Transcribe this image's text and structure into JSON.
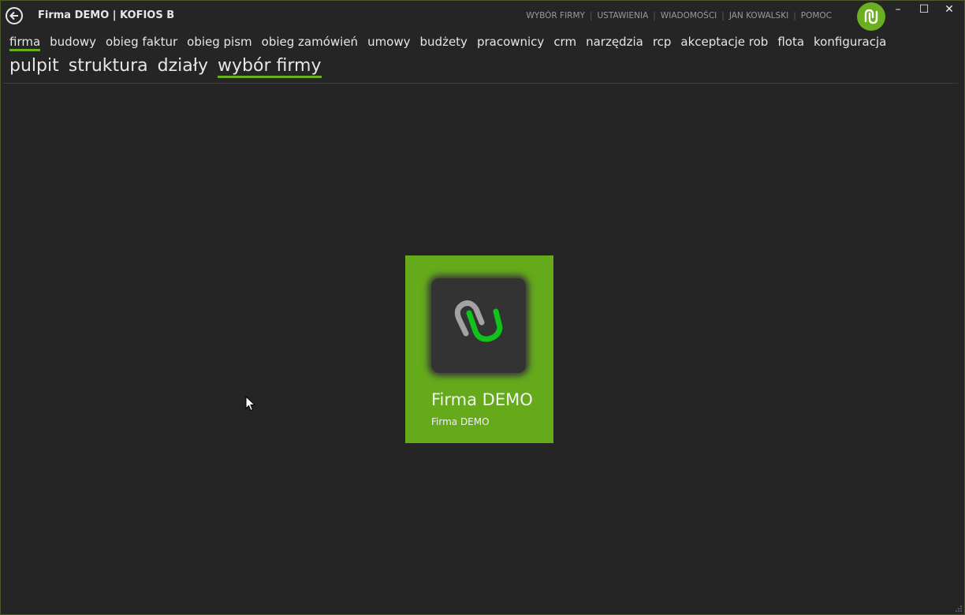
{
  "window": {
    "title": "Firma DEMO | KOFIOS B",
    "accent_color": "#6aaf1f",
    "controls": {
      "minimize": "–",
      "maximize": "☐",
      "close": "✕"
    }
  },
  "top_links": [
    {
      "label": "WYBÓR FIRMY"
    },
    {
      "label": "USTAWIENIA"
    },
    {
      "label": "WIADOMOŚCI"
    },
    {
      "label": "JAN KOWALSKI"
    },
    {
      "label": "POMOC"
    }
  ],
  "main_menu": {
    "items": [
      {
        "label": "firma",
        "active": true
      },
      {
        "label": "budowy"
      },
      {
        "label": "obieg faktur"
      },
      {
        "label": "obieg pism"
      },
      {
        "label": "obieg zamówień"
      },
      {
        "label": "umowy"
      },
      {
        "label": "budżety"
      },
      {
        "label": "pracownicy"
      },
      {
        "label": "crm"
      },
      {
        "label": "narzędzia"
      },
      {
        "label": "rcp"
      },
      {
        "label": "akceptacje rob"
      },
      {
        "label": "flota"
      },
      {
        "label": "konfiguracja"
      }
    ]
  },
  "sub_menu": {
    "items": [
      {
        "label": "pulpit"
      },
      {
        "label": "struktura"
      },
      {
        "label": "działy"
      },
      {
        "label": "wybór firmy",
        "active": true
      }
    ]
  },
  "company_tile": {
    "name": "Firma DEMO",
    "subtitle": "Firma DEMO",
    "background_color": "#64aa1b",
    "icon": "kofios-logo-icon"
  }
}
